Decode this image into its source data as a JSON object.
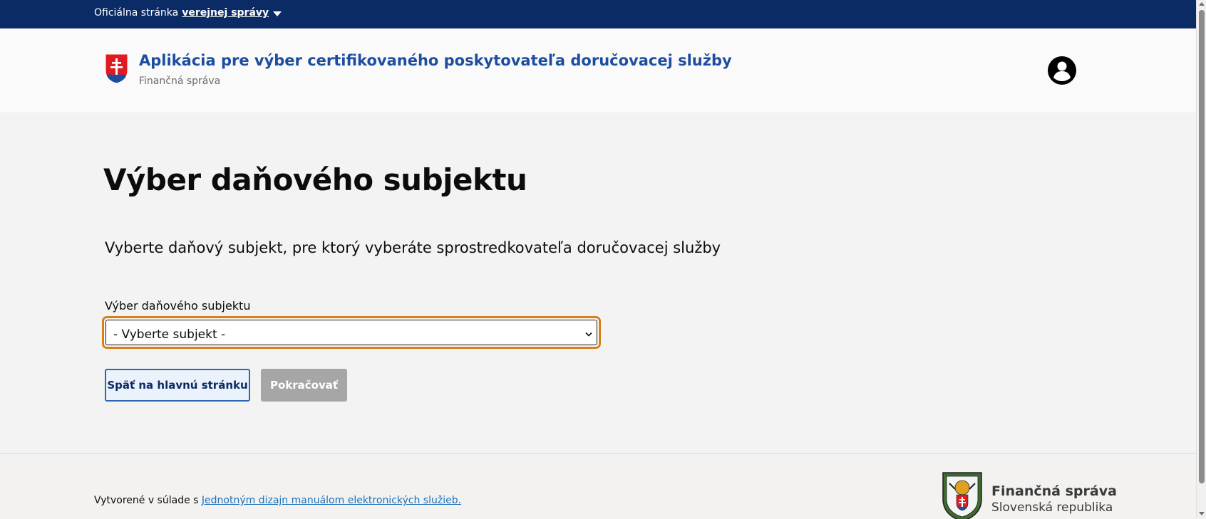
{
  "gov_banner": {
    "prefix": "Oficiálna stránka",
    "link": "verejnej správy",
    "icon": "caret-down-icon"
  },
  "header": {
    "title": "Aplikácia pre výber certifikovaného poskytovateľa doručovacej služby",
    "subtitle": "Finančná správa",
    "logo_icon": "slovak-coat-of-arms-icon",
    "user_icon": "user-account-icon"
  },
  "main": {
    "title": "Výber daňového subjektu",
    "lead": "Vyberte daňový subjekt, pre ktorý vyberáte sprostredkovateľa doručovacej služby",
    "select": {
      "label": "Výber daňového subjektu",
      "value": "- Vyberte subjekt -"
    },
    "buttons": {
      "back": "Späť na hlavnú stránku",
      "continue": "Pokračovať"
    }
  },
  "footer": {
    "text": "Vytvorené v súlade s",
    "link": "Jednotným dizajn manuálom elektronických služieb.",
    "logo_name": "Finančná správa",
    "logo_country": "Slovenská republika",
    "emblem_icon": "financna-sprava-emblem-icon"
  },
  "colors": {
    "banner": "#0b2b66",
    "title_blue": "#1d4d9f",
    "focus": "#d7801a",
    "link": "#1d70b8",
    "disabled": "#a6a6a6"
  }
}
